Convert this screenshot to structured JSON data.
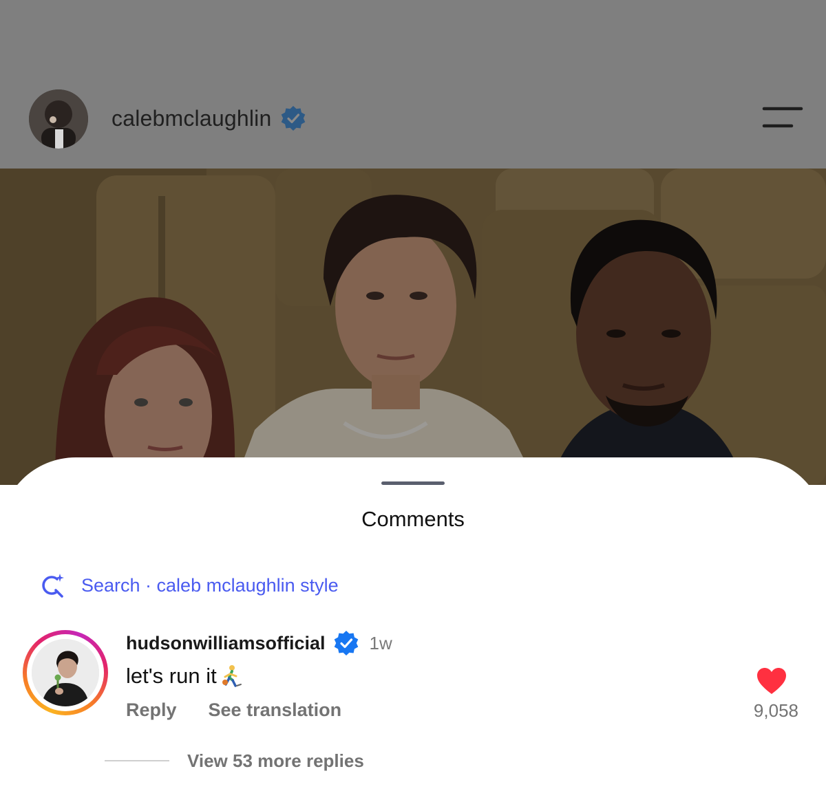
{
  "post": {
    "author_name": "calebmclaughlin",
    "verified": true
  },
  "icons": {
    "menu": "menu-icon",
    "verified": "verified-badge-icon",
    "search": "ai-search-sparkle-icon",
    "like": "heart-filled-icon",
    "emoji": "person-bouncing-ball-emoji"
  },
  "colors": {
    "verified_blue": "#1877f2",
    "search_link": "#4a5bf0",
    "like_red": "#ff3040"
  },
  "comments_sheet": {
    "title": "Comments",
    "search_suggestion": "Search · caleb mclaughlin style",
    "comments": [
      {
        "username": "hudsonwilliamsofficial",
        "verified": true,
        "time": "1w",
        "text": "let's run it",
        "reply_label": "Reply",
        "translate_label": "See translation",
        "likes": "9,058",
        "liked": true,
        "view_replies": "View 53 more replies"
      }
    ]
  }
}
